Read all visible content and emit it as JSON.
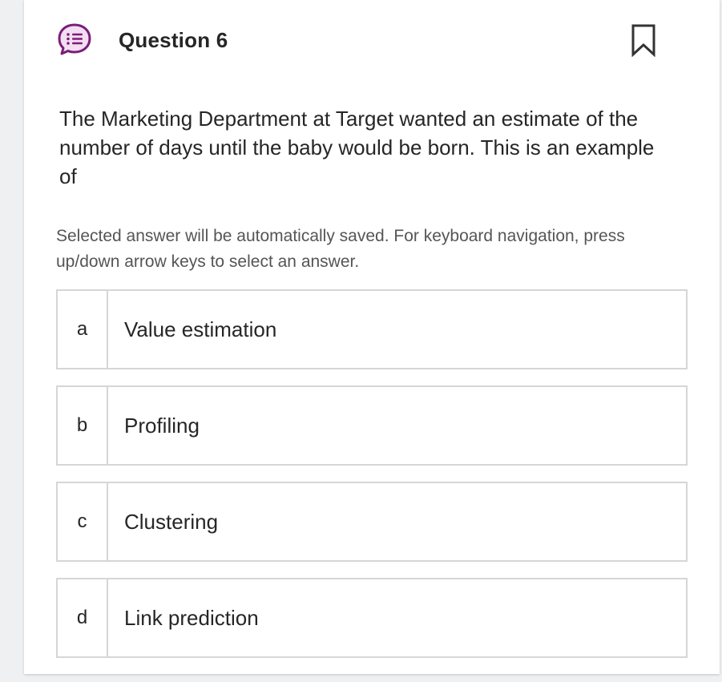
{
  "question": {
    "title": "Question 6",
    "text": "The Marketing Department at Target wanted an estimate of the number of days until the baby would be born.  This is an example of",
    "instructions": "Selected answer will be automatically saved. For keyboard navigation, press up/down arrow keys to select an answer."
  },
  "options": [
    {
      "letter": "a",
      "label": "Value estimation"
    },
    {
      "letter": "b",
      "label": "Profiling"
    },
    {
      "letter": "c",
      "label": "Clustering"
    },
    {
      "letter": "d",
      "label": "Link prediction"
    }
  ],
  "colors": {
    "icon_accent": "#7b1e79",
    "icon_fill": "#f3dff1",
    "border": "#d6d6d6",
    "text": "#262626",
    "muted_text": "#555555"
  },
  "icons": {
    "question_type": "multiple-choice-icon",
    "flag": "bookmark-flag-icon"
  }
}
